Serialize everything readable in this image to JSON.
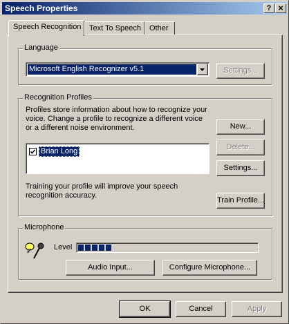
{
  "window": {
    "title": "Speech Properties",
    "help_button": "?",
    "close_button": "×"
  },
  "tabs": [
    {
      "label": "Speech Recognition",
      "active": true
    },
    {
      "label": "Text To Speech",
      "active": false
    },
    {
      "label": "Other",
      "active": false
    }
  ],
  "language": {
    "group_label": "Language",
    "selected_recognizer": "Microsoft English Recognizer v5.1",
    "settings_button": "Settings..."
  },
  "profiles": {
    "group_label": "Recognition Profiles",
    "description_lines": [
      "Profiles store information about how to recognize your",
      "voice.  Change a profile to recognize a different voice",
      "or a different noise environment."
    ],
    "items": [
      {
        "name": "Brian Long",
        "checked": true,
        "selected": true
      }
    ],
    "new_button": "New...",
    "delete_button": "Delete...",
    "settings_button": "Settings...",
    "training_lines": [
      "Training your profile will improve your speech",
      "recognition accuracy."
    ],
    "train_button": "Train Profile..."
  },
  "microphone": {
    "group_label": "Microphone",
    "level_label": "Level",
    "level_fraction": 0.18,
    "audio_input_button": "Audio Input...",
    "configure_button": "Configure Microphone..."
  },
  "dialog_buttons": {
    "ok": "OK",
    "cancel": "Cancel",
    "apply": "Apply"
  },
  "colors": {
    "face": "#d4d0c8",
    "selection": "#0a246a",
    "title_start": "#0a246a",
    "title_end": "#a6caf0",
    "level_block": "#0a246a"
  }
}
